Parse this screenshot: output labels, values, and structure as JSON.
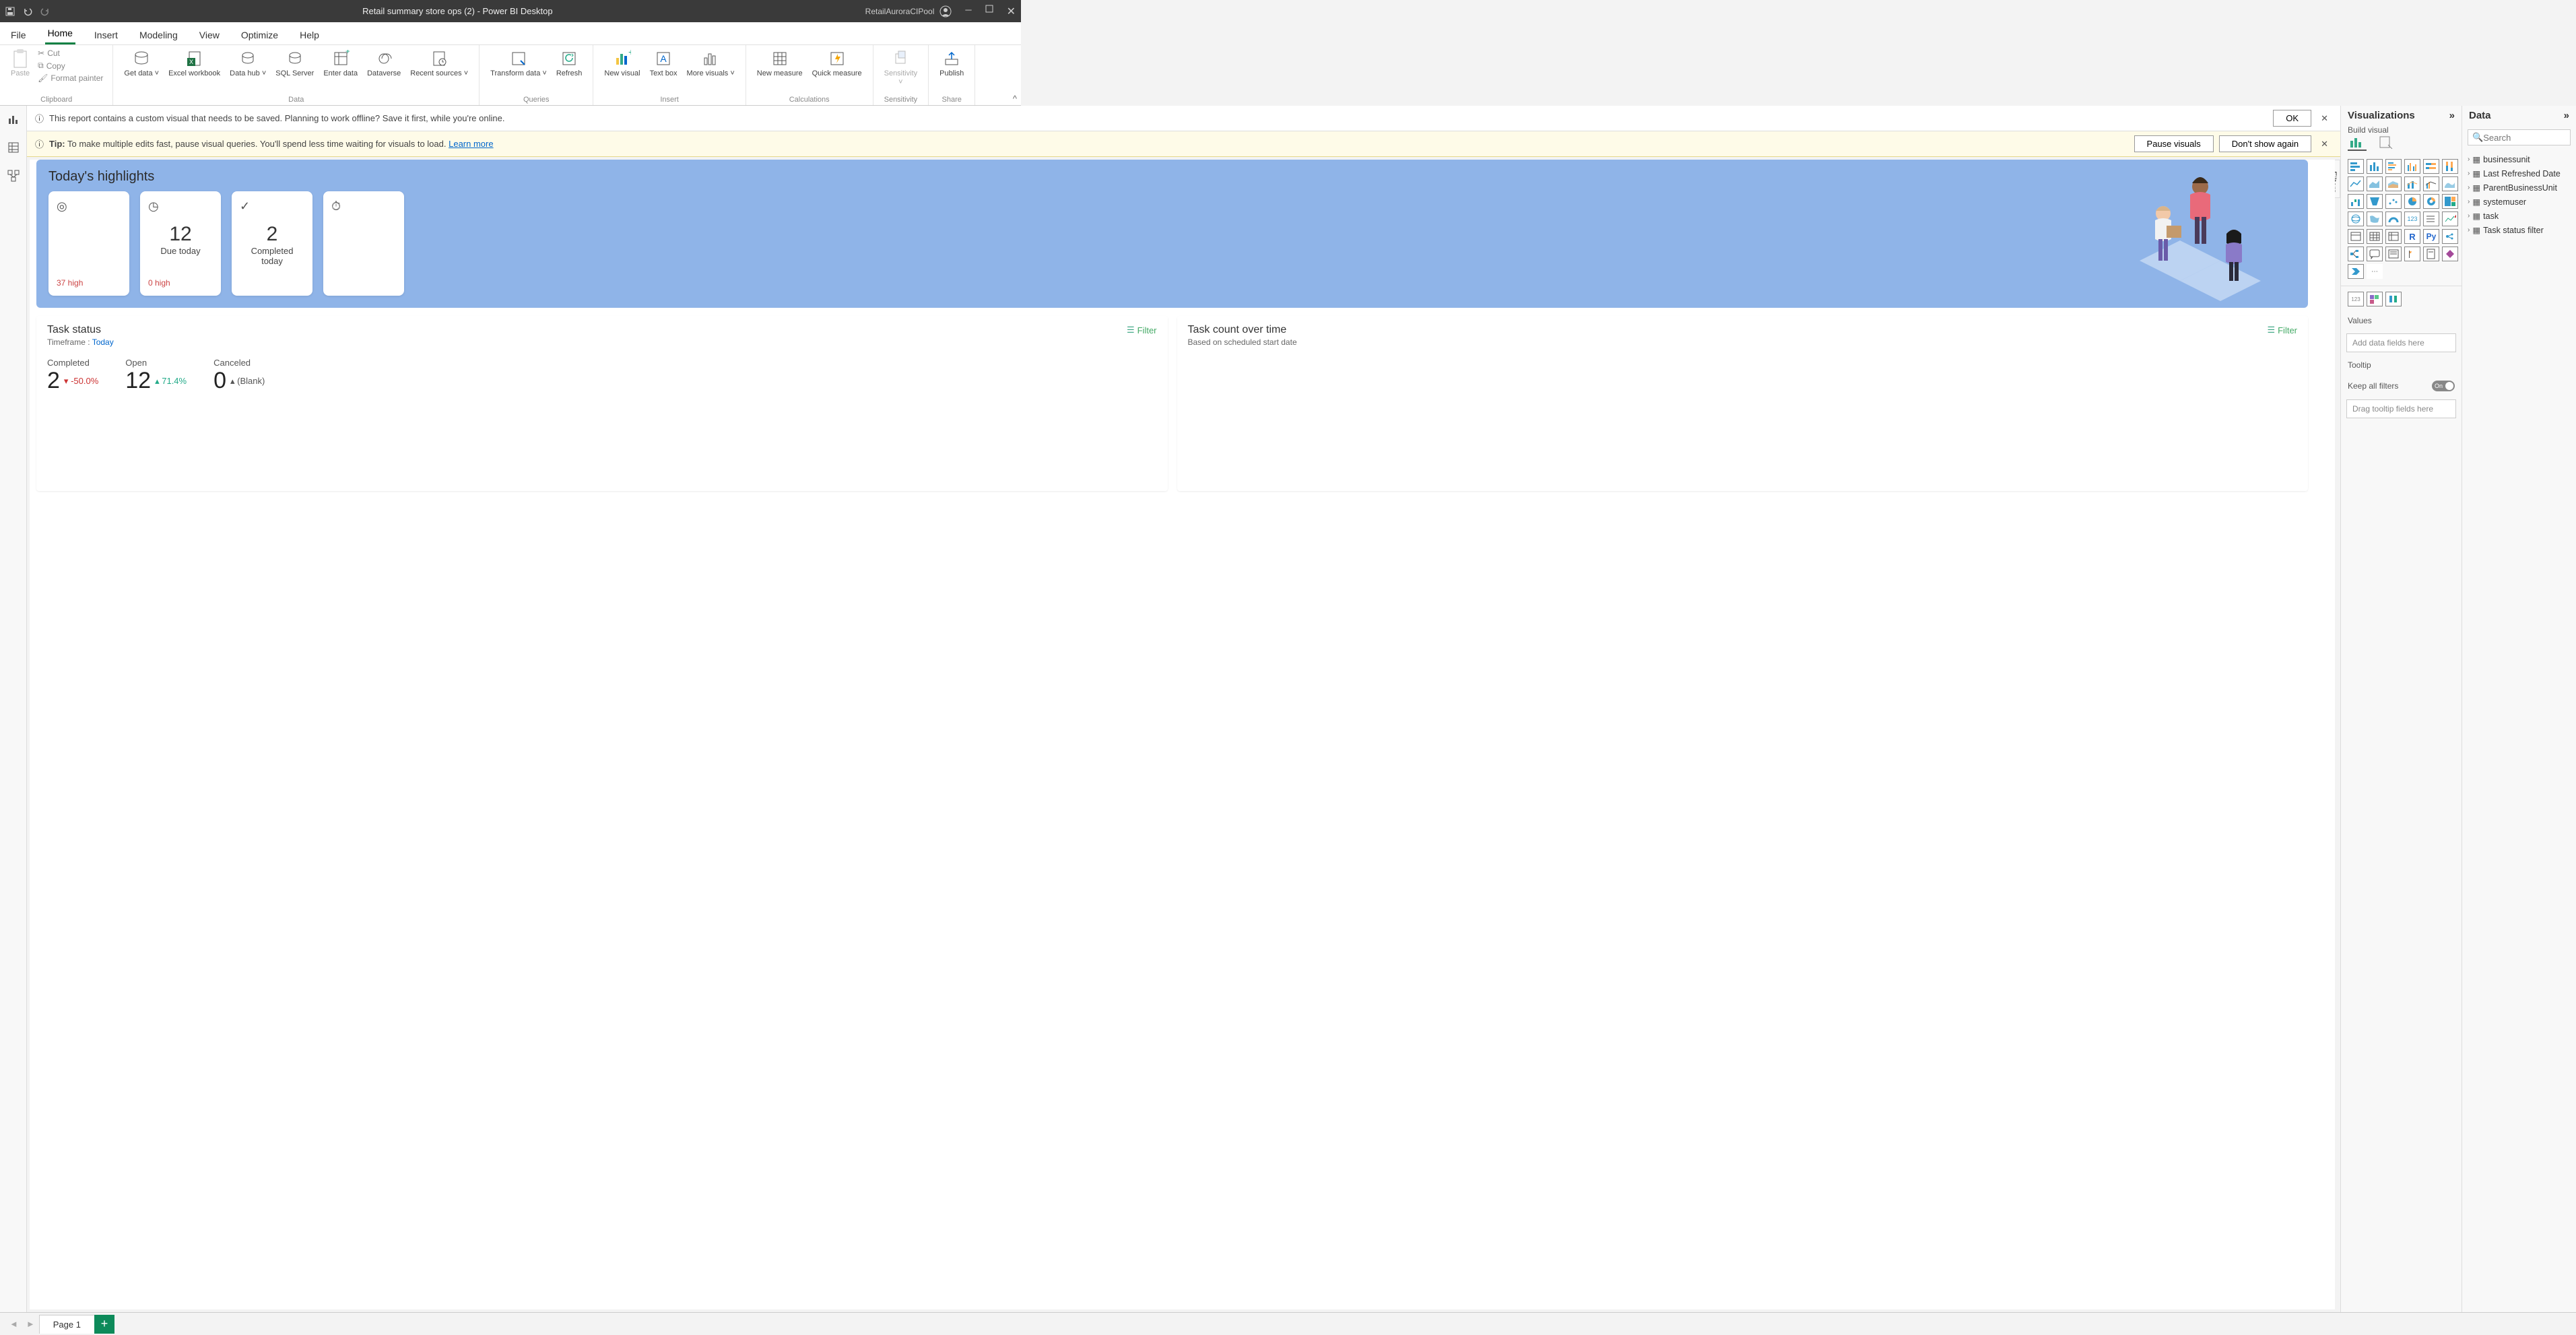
{
  "titlebar": {
    "title": "Retail summary store ops (2) - Power BI Desktop",
    "user": "RetailAuroraCIPool"
  },
  "menubar": [
    "File",
    "Home",
    "Insert",
    "Modeling",
    "View",
    "Optimize",
    "Help"
  ],
  "ribbon": {
    "clipboard": {
      "paste": "Paste",
      "cut": "Cut",
      "copy": "Copy",
      "format": "Format painter",
      "label": "Clipboard"
    },
    "data": {
      "get": "Get data",
      "excel": "Excel workbook",
      "hub": "Data hub",
      "sql": "SQL Server",
      "enter": "Enter data",
      "dataverse": "Dataverse",
      "recent": "Recent sources",
      "label": "Data"
    },
    "queries": {
      "transform": "Transform data",
      "refresh": "Refresh",
      "label": "Queries"
    },
    "insert": {
      "visual": "New visual",
      "text": "Text box",
      "more": "More visuals",
      "label": "Insert"
    },
    "calc": {
      "measure": "New measure",
      "quick": "Quick measure",
      "label": "Calculations"
    },
    "sens": {
      "sensitivity": "Sensitivity",
      "label": "Sensitivity"
    },
    "share": {
      "publish": "Publish",
      "label": "Share"
    }
  },
  "banner1": {
    "msg": "This report contains a custom visual that needs to be saved. Planning to work offline? Save it first, while you're online.",
    "ok": "OK"
  },
  "banner2": {
    "tip": "Tip:",
    "msg": " To make multiple edits fast, pause visual queries. You'll spend less time waiting for visuals to load. ",
    "link": "Learn more",
    "pause": "Pause visuals",
    "dont": "Don't show again"
  },
  "filters_tab": "Filters",
  "highlights": {
    "title": "Today's highlights",
    "cards": [
      {
        "big": "",
        "sub": "",
        "foot": "37 high"
      },
      {
        "big": "12",
        "sub": "Due today",
        "foot": "0 high"
      },
      {
        "big": "2",
        "sub": "Completed today",
        "foot": ""
      },
      {
        "big": "",
        "sub": "",
        "foot": ""
      }
    ]
  },
  "taskstatus": {
    "title": "Task status",
    "filter": "Filter",
    "timeframe": "Timeframe : ",
    "today": "Today",
    "kpis": [
      {
        "label": "Completed",
        "value": "2",
        "delta": "-50.0%",
        "dir": "down"
      },
      {
        "label": "Open",
        "value": "12",
        "delta": "71.4%",
        "dir": "up"
      },
      {
        "label": "Canceled",
        "value": "0",
        "delta": "(Blank)",
        "dir": "up"
      }
    ]
  },
  "taskcount": {
    "title": "Task count over time",
    "sub": "Based on scheduled start date",
    "filter": "Filter"
  },
  "viz": {
    "title": "Visualizations",
    "build": "Build visual",
    "values_label": "Values",
    "values_placeholder": "Add data fields here",
    "tooltip_label": "Tooltip",
    "keepall": "Keep all filters",
    "tooltip_placeholder": "Drag tooltip fields here",
    "toggle": "On"
  },
  "data": {
    "title": "Data",
    "search": "Search",
    "items": [
      "businessunit",
      "Last Refreshed Date",
      "ParentBusinessUnit",
      "systemuser",
      "task",
      "Task status filter"
    ]
  },
  "page": {
    "name": "Page 1"
  }
}
